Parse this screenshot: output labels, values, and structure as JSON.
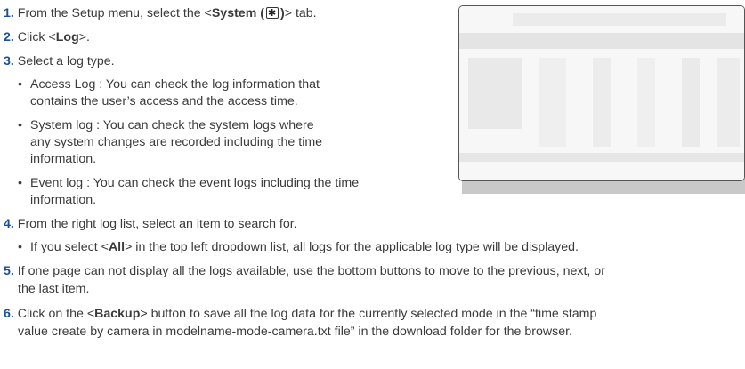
{
  "steps": [
    {
      "num": "1.",
      "pre": " From the Setup menu, select the <",
      "bold": "System (",
      "bold_after_icon": ")",
      "post": "> tab."
    },
    {
      "num": "2.",
      "pre": " Click <",
      "bold": "Log",
      "post": ">."
    },
    {
      "num": "3.",
      "text": " Select a log type."
    },
    {
      "num": "4.",
      "text": " From the right log list, select an item to search for."
    },
    {
      "num": "5.",
      "line1": " If one page can not display all the logs available, use the bottom buttons to move to the previous, next, or",
      "line2": "the last item."
    },
    {
      "num": "6.",
      "pre": " Click on the <",
      "bold": "Backup",
      "post": "> button to save all the log data for the currently selected mode in the “time stamp",
      "line2": "value create by camera in modelname-mode-camera.txt file” in the download folder for the browser."
    }
  ],
  "log_types": [
    {
      "bullet": "•",
      "line1": "Access Log : You can check the log information that",
      "line2": "contains the user’s access and the access time."
    },
    {
      "bullet": "•",
      "line1": "System log : You can check the system logs where",
      "line2": "any system changes are recorded including the time",
      "line3": "information."
    },
    {
      "bullet": "•",
      "line1": "Event log : You can check the event logs including the time",
      "line2": "information."
    }
  ],
  "step4_note": {
    "bullet": "•",
    "pre": "If you select <",
    "bold": "All",
    "post": "> in the top left dropdown list, all logs for the applicable log type will be displayed."
  },
  "icons": {
    "system_tab": "gear-icon"
  },
  "colors": {
    "step_number": "#1b4f9a",
    "body_text": "#3a3a3a",
    "screenshot_shadow": "#c9c9c9"
  }
}
